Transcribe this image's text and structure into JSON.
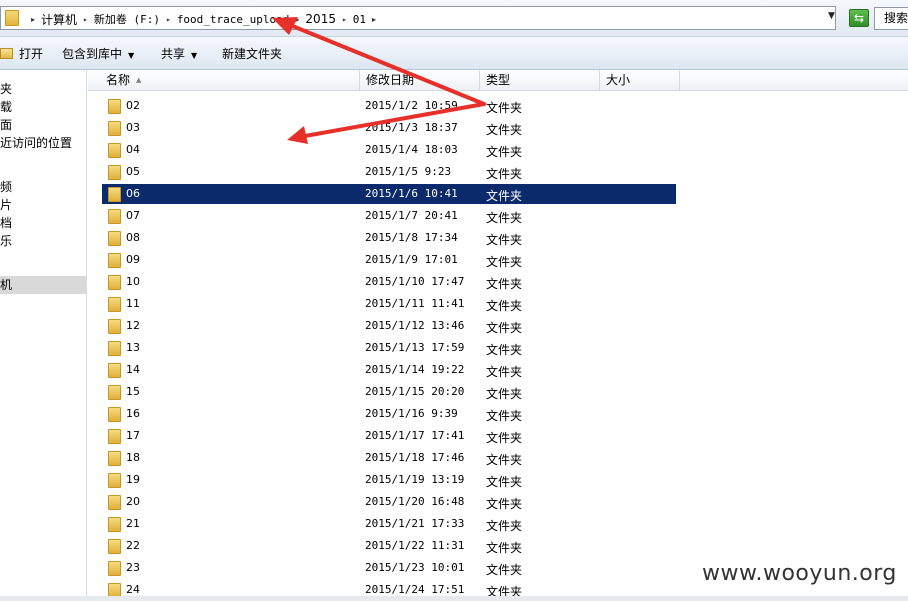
{
  "address": {
    "crumbs": [
      {
        "label": "计算机",
        "mono": false
      },
      {
        "label": "新加卷 (F:)",
        "mono": true
      },
      {
        "label": "food_trace_upload",
        "mono": true
      },
      {
        "label": "2015",
        "mono": false
      },
      {
        "label": "01",
        "mono": true
      }
    ],
    "search_placeholder": "搜索"
  },
  "toolbar": {
    "open_label": "打开",
    "include_label": "包含到库中",
    "share_label": "共享",
    "new_folder_label": "新建文件夹"
  },
  "nav": {
    "items": [
      "夹",
      "载",
      "面",
      "近访问的位置",
      "",
      "频",
      "片",
      "档",
      "乐",
      "",
      "机"
    ],
    "selected_index": 10
  },
  "columns": {
    "name": "名称",
    "date": "修改日期",
    "type": "类型",
    "size": "大小"
  },
  "files": [
    {
      "name": "02",
      "date": "2015/1/2 10:59",
      "type": "文件夹"
    },
    {
      "name": "03",
      "date": "2015/1/3 18:37",
      "type": "文件夹"
    },
    {
      "name": "04",
      "date": "2015/1/4 18:03",
      "type": "文件夹"
    },
    {
      "name": "05",
      "date": "2015/1/5 9:23",
      "type": "文件夹"
    },
    {
      "name": "06",
      "date": "2015/1/6 10:41",
      "type": "文件夹",
      "selected": true
    },
    {
      "name": "07",
      "date": "2015/1/7 20:41",
      "type": "文件夹"
    },
    {
      "name": "08",
      "date": "2015/1/8 17:34",
      "type": "文件夹"
    },
    {
      "name": "09",
      "date": "2015/1/9 17:01",
      "type": "文件夹"
    },
    {
      "name": "10",
      "date": "2015/1/10 17:47",
      "type": "文件夹"
    },
    {
      "name": "11",
      "date": "2015/1/11 11:41",
      "type": "文件夹"
    },
    {
      "name": "12",
      "date": "2015/1/12 13:46",
      "type": "文件夹"
    },
    {
      "name": "13",
      "date": "2015/1/13 17:59",
      "type": "文件夹"
    },
    {
      "name": "14",
      "date": "2015/1/14 19:22",
      "type": "文件夹"
    },
    {
      "name": "15",
      "date": "2015/1/15 20:20",
      "type": "文件夹"
    },
    {
      "name": "16",
      "date": "2015/1/16 9:39",
      "type": "文件夹"
    },
    {
      "name": "17",
      "date": "2015/1/17 17:41",
      "type": "文件夹"
    },
    {
      "name": "18",
      "date": "2015/1/18 17:46",
      "type": "文件夹"
    },
    {
      "name": "19",
      "date": "2015/1/19 13:19",
      "type": "文件夹"
    },
    {
      "name": "20",
      "date": "2015/1/20 16:48",
      "type": "文件夹"
    },
    {
      "name": "21",
      "date": "2015/1/21 17:33",
      "type": "文件夹"
    },
    {
      "name": "22",
      "date": "2015/1/22 11:31",
      "type": "文件夹"
    },
    {
      "name": "23",
      "date": "2015/1/23 10:01",
      "type": "文件夹"
    },
    {
      "name": "24",
      "date": "2015/1/24 17:51",
      "type": "文件夹"
    }
  ],
  "watermark": "www.wooyun.org",
  "colors": {
    "selection": "#0b2a6b",
    "annotation_arrow": "#e8302a"
  }
}
